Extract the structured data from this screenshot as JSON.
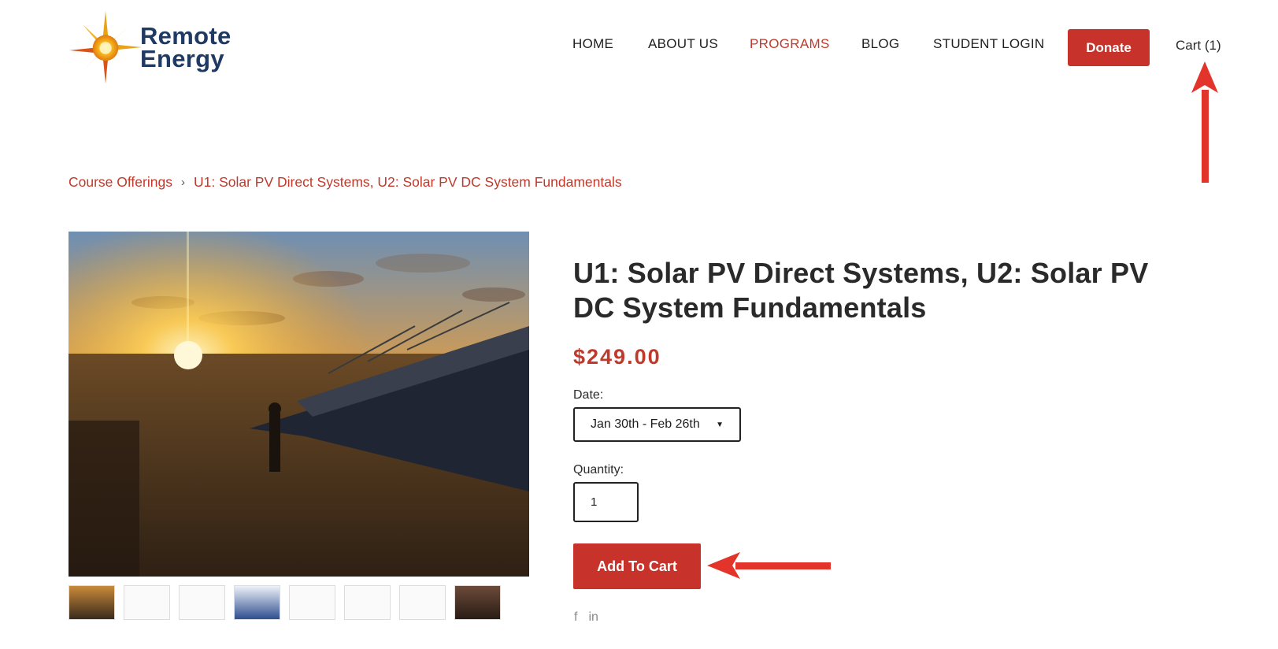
{
  "brand": {
    "name_line1": "Remote",
    "name_line2": "Energy"
  },
  "nav": {
    "items": [
      {
        "label": "HOME"
      },
      {
        "label": "ABOUT US"
      },
      {
        "label": "PROGRAMS"
      },
      {
        "label": "BLOG"
      },
      {
        "label": "STUDENT LOGIN"
      }
    ],
    "donate_label": "Donate",
    "cart_label": "Cart (1)"
  },
  "breadcrumb": {
    "parent": "Course Offerings",
    "separator": "›",
    "current": "U1: Solar PV Direct Systems, U2: Solar PV DC System Fundamentals"
  },
  "product": {
    "title": "U1: Solar PV Direct Systems, U2: Solar PV DC System Fundamentals",
    "price": "$249.00",
    "date_label": "Date:",
    "date_value": "Jan 30th - Feb 26th",
    "quantity_label": "Quantity:",
    "quantity_value": "1",
    "add_to_cart_label": "Add To Cart",
    "share": {
      "facebook": "f",
      "linkedin": "in"
    }
  },
  "colors": {
    "accent": "#c7322b",
    "brand_navy": "#1f3a63",
    "active_nav": "#c0392b"
  }
}
